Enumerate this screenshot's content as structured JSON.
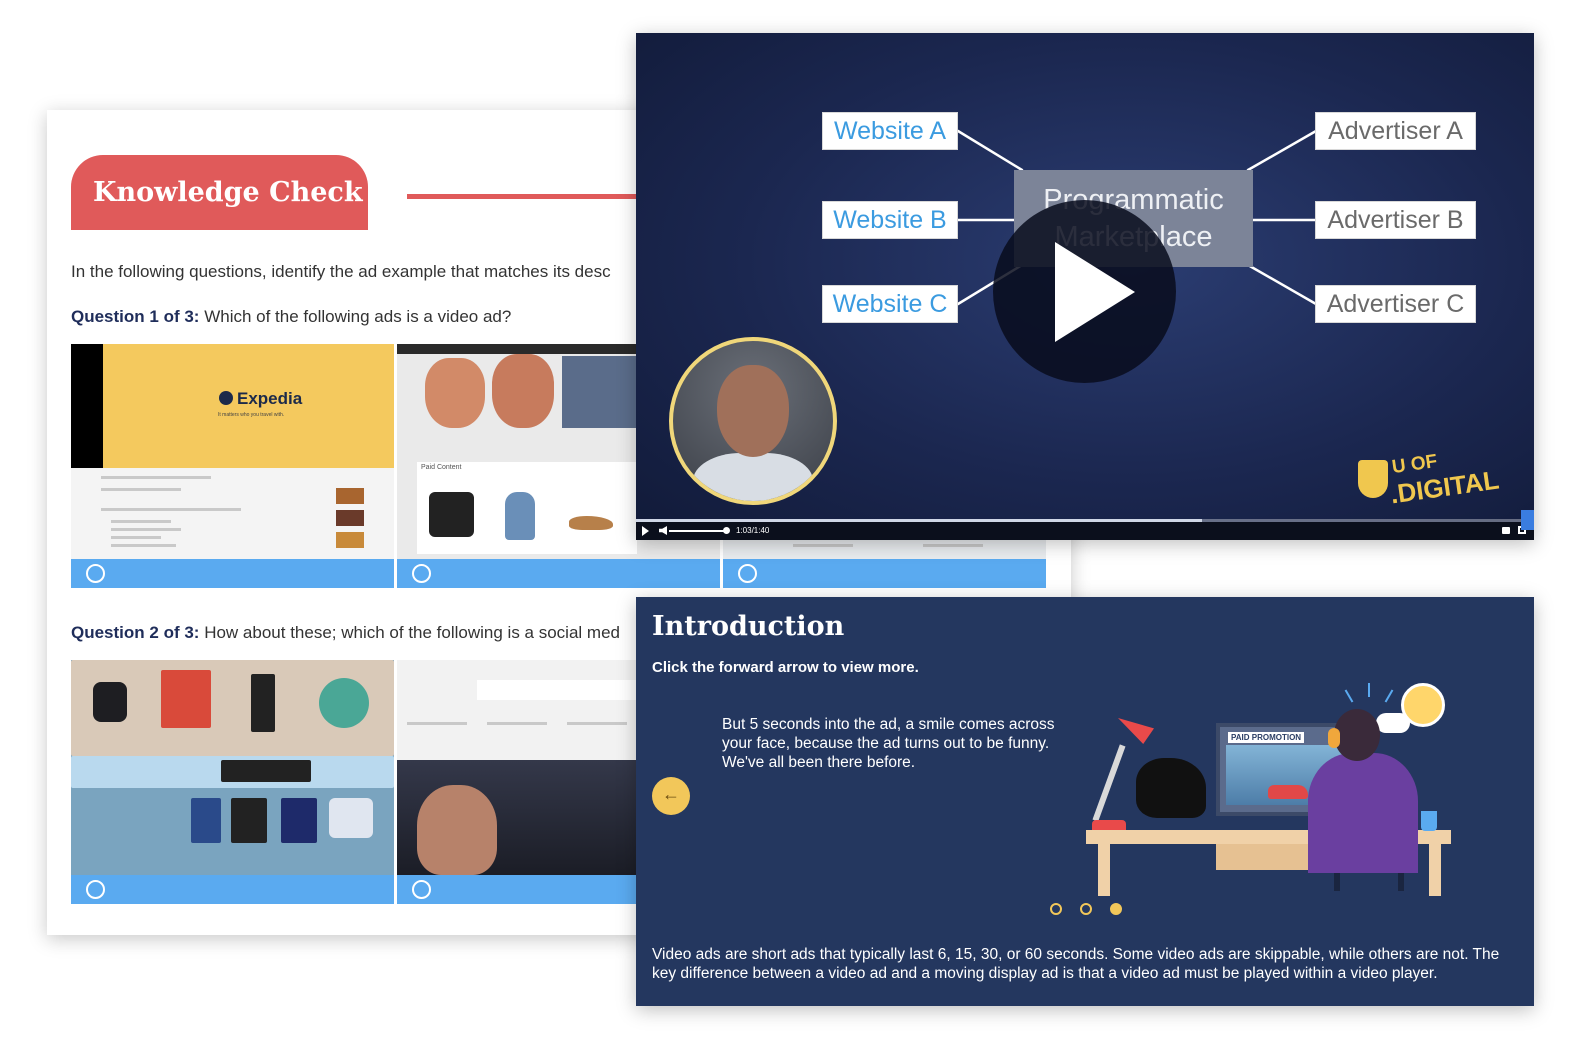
{
  "knowledge_check": {
    "title": "Knowledge Check",
    "intro": "In the following questions, identify the ad example that matches its desc",
    "question1": {
      "number": "Question 1 of 3:",
      "text": "Which of the following ads is a video ad?"
    },
    "question2": {
      "number": "Question 2 of 3:",
      "text": "How about these; which of the following is a social med"
    },
    "tile_expedia_brand": "Expedia",
    "tile_expedia_tagline": "It matters who you travel with.",
    "tile_paid_content": "Paid Content"
  },
  "video": {
    "sites": [
      "Website A",
      "Website B",
      "Website C"
    ],
    "advertisers": [
      "Advertiser A",
      "Advertiser B",
      "Advertiser C"
    ],
    "hub_line1": "Programmatic",
    "hub_line2": "Marketplace",
    "time": "1:03/1:40",
    "progress": 0.63,
    "logo_u": "U OF",
    "logo_digital": ".DIGITAL"
  },
  "intro_card": {
    "title": "Introduction",
    "subtitle": "Click the forward arrow to view more.",
    "body": "But 5 seconds into the ad, a smile comes across your face, because the ad turns out to be funny. We've all been there before.",
    "back_icon": "arrow-left-icon",
    "back_glyph": "←",
    "paid_label": "PAID PROMOTION",
    "dots_total": 3,
    "dots_active": 3,
    "footer": "Video ads are short ads that typically last 6, 15, 30, or 60 seconds. Some video ads are skippable, while others are not. The key difference between a video ad and a moving display ad is that a video ad must be played within a video player."
  },
  "colors": {
    "accent_red": "#e05a5a",
    "answer_bar": "#5aaaf0",
    "intro_bg": "#24375f",
    "gold": "#f2c75a"
  }
}
